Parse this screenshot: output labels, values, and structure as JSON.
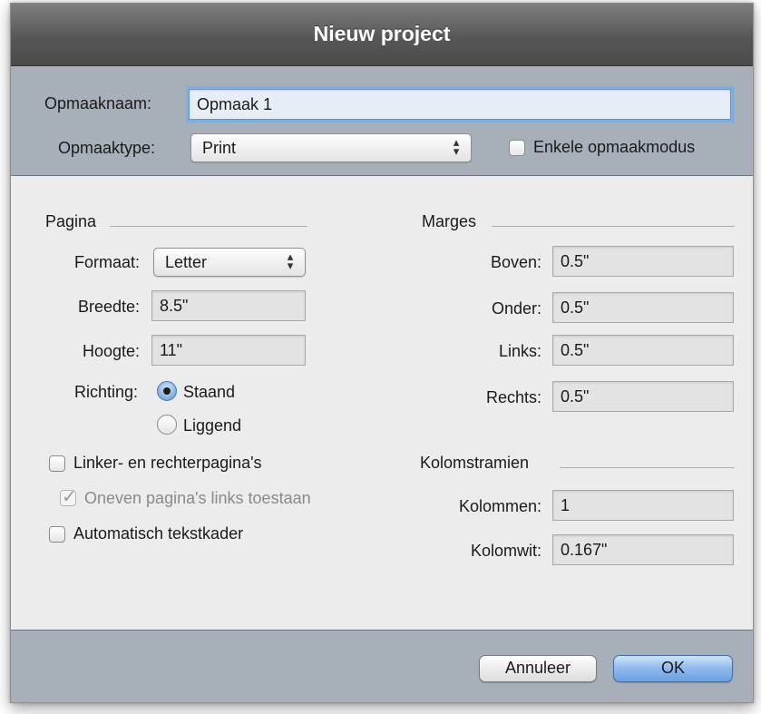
{
  "window": {
    "title": "Nieuw project"
  },
  "header": {
    "layout_name_label": "Opmaaknaam:",
    "layout_name_value": "Opmaak 1",
    "layout_type_label": "Opmaaktype:",
    "layout_type_value": "Print",
    "single_layout_label": "Enkele opmaakmodus"
  },
  "page": {
    "section_title": "Pagina",
    "format_label": "Formaat:",
    "format_value": "Letter",
    "width_label": "Breedte:",
    "width_value": "8.5\"",
    "height_label": "Hoogte:",
    "height_value": "11\"",
    "orientation_label": "Richting:",
    "portrait_label": "Staand",
    "landscape_label": "Liggend",
    "facing_pages_label": "Linker- en rechterpagina's",
    "allow_odd_label": "Oneven pagina's links toestaan",
    "auto_text_box_label": "Automatisch tekstkader"
  },
  "margins": {
    "section_title": "Marges",
    "top_label": "Boven:",
    "top_value": "0.5\"",
    "bottom_label": "Onder:",
    "bottom_value": "0.5\"",
    "left_label": "Links:",
    "left_value": "0.5\"",
    "right_label": "Rechts:",
    "right_value": "0.5\""
  },
  "column_guides": {
    "section_title": "Kolomstramien",
    "columns_label": "Kolommen:",
    "columns_value": "1",
    "gutter_label": "Kolomwit:",
    "gutter_value": "0.167\""
  },
  "buttons": {
    "cancel_label": "Annuleer",
    "ok_label": "OK"
  },
  "state": {
    "orientation": "portrait",
    "single_layout_checked": false,
    "facing_pages_checked": false,
    "allow_odd_checked": true,
    "allow_odd_enabled": false,
    "auto_text_box_checked": false
  },
  "icons": {
    "popup_arrows": "updown-arrows-icon",
    "checkmark": "checkmark-icon",
    "radio_dot": "radio-dot-icon"
  },
  "colors": {
    "title_bar": "#575757",
    "header_footer_bg": "#a7b0b8",
    "dialog_body": "#ececec",
    "focus_ring": "#7eaee0",
    "default_button": "#8fb9ec"
  }
}
